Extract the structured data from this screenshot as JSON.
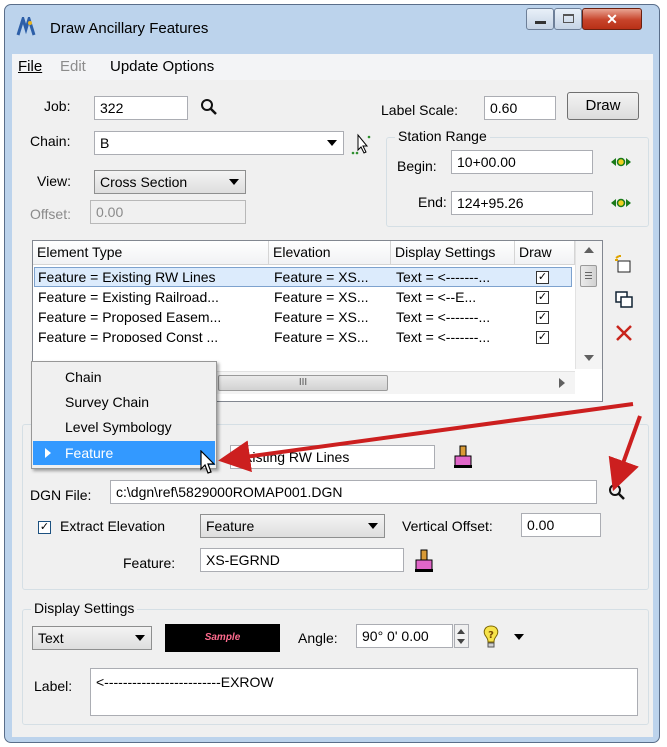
{
  "window": {
    "title": "Draw Ancillary Features"
  },
  "menu": {
    "file": "File",
    "edit": "Edit",
    "update_options": "Update Options"
  },
  "job": {
    "label": "Job:",
    "value": "322"
  },
  "label_scale": {
    "label": "Label Scale:",
    "value": "0.60"
  },
  "draw_button": "Draw",
  "chain": {
    "label": "Chain:",
    "value": "B"
  },
  "view": {
    "label": "View:",
    "value": "Cross Section"
  },
  "offset": {
    "label": "Offset:",
    "value": "0.00"
  },
  "station_range": {
    "title": "Station Range",
    "begin_label": "Begin:",
    "begin_value": "10+00.00",
    "end_label": "End:",
    "end_value": "124+95.26"
  },
  "table": {
    "columns": [
      "Element Type",
      "Elevation",
      "Display Settings",
      "Draw"
    ],
    "rows": [
      {
        "element_type": "Feature = Existing RW Lines",
        "elevation": "Feature = XS...",
        "display": "Text = <-------...",
        "draw": true
      },
      {
        "element_type": "Feature = Existing Railroad...",
        "elevation": "Feature = XS...",
        "display": "Text = <--E...",
        "draw": true
      },
      {
        "element_type": "Feature = Proposed Easem...",
        "elevation": "Feature = XS...",
        "display": "Text = <-------...",
        "draw": true
      },
      {
        "element_type": "Feature = Proposed Const ...",
        "elevation": "Feature = XS...",
        "display": "Text = <-------...",
        "draw": true
      }
    ],
    "hscroll_grip": "III"
  },
  "popup_menu": {
    "items": [
      "Chain",
      "Survey Chain",
      "Level Symbology",
      "Feature"
    ],
    "selected": "Feature"
  },
  "element_feature": {
    "value": "Existing RW Lines"
  },
  "dgn_file": {
    "label": "DGN File:",
    "value": "c:\\dgn\\ref\\5829000ROMAP001.DGN"
  },
  "extract_elevation": {
    "label": "Extract Elevation",
    "checked": true,
    "mode": "Feature",
    "vertical_offset_label": "Vertical Offset:",
    "vertical_offset_value": "0.00"
  },
  "feature": {
    "label": "Feature:",
    "value": "XS-EGRND"
  },
  "display_settings": {
    "title": "Display Settings",
    "type": "Text",
    "sample": "Sample",
    "angle_label": "Angle:",
    "angle_value": "90° 0' 0.00",
    "label_label": "Label:",
    "label_value": "<-------------------------EXROW"
  },
  "colors": {
    "selection": "#3399ff",
    "arrow": "#cc1f1f",
    "title_bg": "#bcd3ec"
  }
}
